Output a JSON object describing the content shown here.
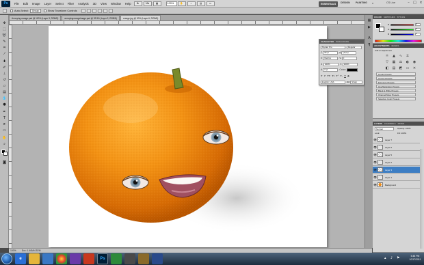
{
  "menubar": {
    "logo": "Ps",
    "items": [
      "File",
      "Edit",
      "Image",
      "Layer",
      "Select",
      "Filter",
      "Analysis",
      "3D",
      "View",
      "Window",
      "Help"
    ],
    "zoom": "100%",
    "workspaces": [
      "ESSENTIALS",
      "DESIGN",
      "PAINTING",
      "»"
    ],
    "cs_live": "CS Live"
  },
  "options": {
    "auto_select_label": "Auto-Select:",
    "auto_select_value": "Group",
    "transform_label": "Show Transform Controls"
  },
  "tabs": [
    "Annoying orange.psd @ 100% (Layer 3, RGB/8)",
    "annoyingorangeimage.psd @ 33.3% (Layer 2, RGB/8)",
    "orange.jpg @ 50% (Layer 6, RGB/8)"
  ],
  "status": {
    "zoom": "100%",
    "doc": "Doc: 1.46M/4.52M"
  },
  "character": {
    "tabs": [
      "CHARACTER",
      "PARAGRAPH"
    ],
    "font_family": "Myriad Pro",
    "font_style": "Regular",
    "size": "30 pt",
    "leading": "(Auto)",
    "kerning": "Metrics",
    "tracking": "0",
    "vscale": "100%",
    "hscale": "100%",
    "baseline": "0 pt",
    "color_label": "Color:",
    "language": "English: USA",
    "aa": "Sharp"
  },
  "color_panel": {
    "tabs": [
      "COLOR",
      "SWATCHES",
      "STYLES"
    ],
    "r": "0",
    "g": "0",
    "b": "0"
  },
  "adjustments": {
    "tabs": [
      "ADJUSTMENTS",
      "MASKS"
    ],
    "hint": "Add an adjustment",
    "presets": [
      "Levels Presets",
      "Curves Presets",
      "Exposure Presets",
      "Hue/Saturation Presets",
      "Black & White Presets",
      "Channel Mixer Presets",
      "Selective Color Presets"
    ]
  },
  "layers_panel": {
    "tabs": [
      "LAYERS",
      "CHANNELS",
      "PATHS"
    ],
    "blend": "Normal",
    "opacity": "Opacity: 100%",
    "fill": "Fill: 100%",
    "lock": "Lock:",
    "layers": [
      {
        "name": "Layer 7",
        "selected": false
      },
      {
        "name": "Layer 6",
        "selected": false
      },
      {
        "name": "Layer 5",
        "selected": false
      },
      {
        "name": "Layer 2",
        "selected": false
      },
      {
        "name": "Layer 3",
        "selected": true
      },
      {
        "name": "Layer 1",
        "selected": false
      },
      {
        "name": "Background",
        "selected": false
      }
    ]
  },
  "taskbar": {
    "apps": [
      "e",
      "",
      "",
      "",
      "",
      "",
      "Ps",
      "",
      "",
      "",
      ""
    ],
    "time": "5:48 PM",
    "date": "10/17/2011"
  },
  "colors": {
    "selection": "#3d7ec4",
    "orange": "#ef8a10",
    "taskbar": "#1d2c3d"
  }
}
